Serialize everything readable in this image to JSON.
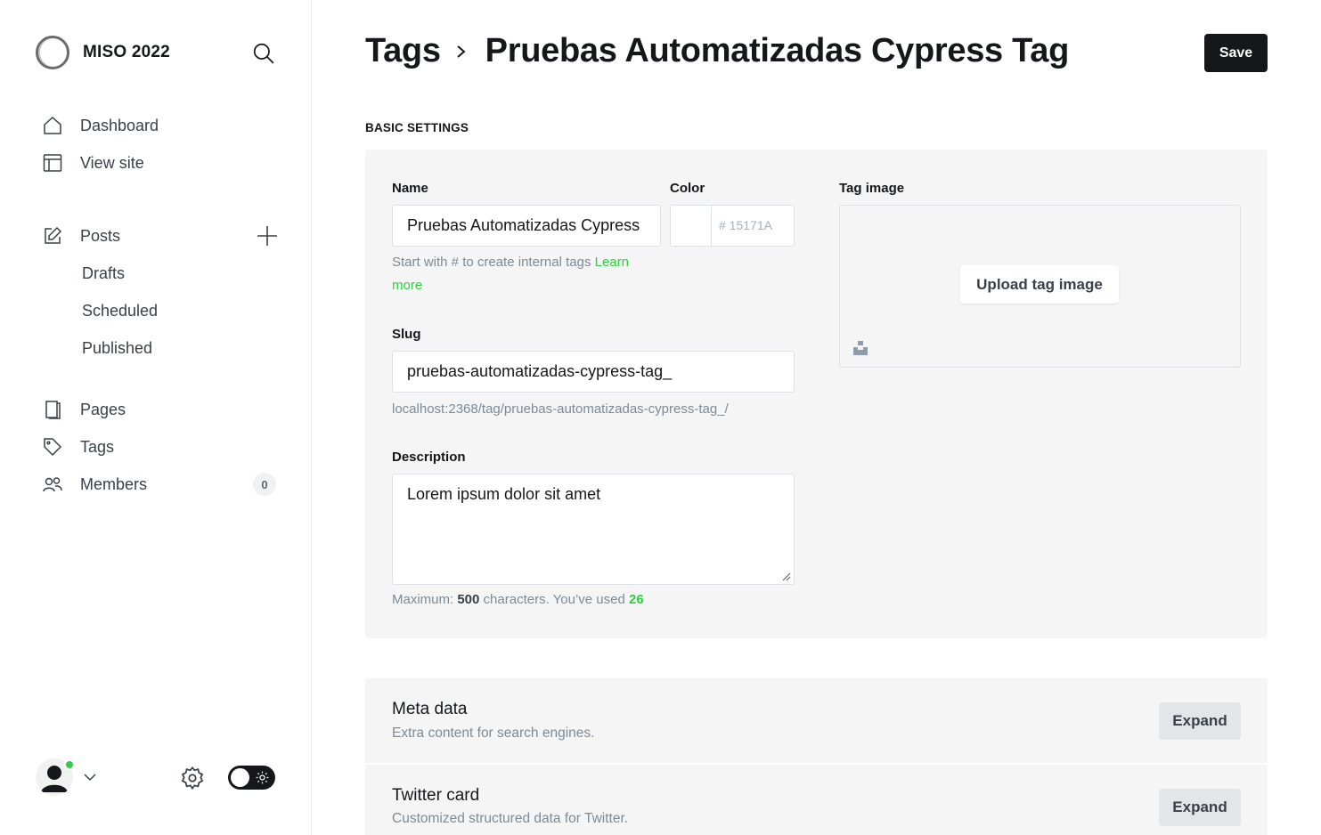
{
  "brand": {
    "name": "MISO 2022"
  },
  "sidebar": {
    "nav": [
      {
        "label": "Dashboard",
        "icon": "home-icon"
      },
      {
        "label": "View site",
        "icon": "layout-icon"
      }
    ],
    "posts": {
      "label": "Posts",
      "icon": "edit-icon"
    },
    "post_subitems": [
      "Drafts",
      "Scheduled",
      "Published"
    ],
    "nav2": [
      {
        "label": "Pages",
        "icon": "page-icon"
      },
      {
        "label": "Tags",
        "icon": "tag-icon"
      },
      {
        "label": "Members",
        "icon": "members-icon",
        "count": "0"
      }
    ]
  },
  "header": {
    "breadcrumb_parent": "Tags",
    "breadcrumb_current": "Pruebas Automatizadas Cypress Tag",
    "save_label": "Save"
  },
  "basic": {
    "section_title": "BASIC SETTINGS",
    "name_label": "Name",
    "name_value": "Pruebas Automatizadas Cypress",
    "name_hint": "Start with # to create internal tags",
    "learn_more": "Learn more",
    "color_label": "Color",
    "color_placeholder": "# 15171A",
    "slug_label": "Slug",
    "slug_value": "pruebas-automatizadas-cypress-tag_",
    "slug_url": "localhost:2368/tag/pruebas-automatizadas-cypress-tag_/",
    "description_label": "Description",
    "description_value": "Lorem ipsum dolor sit amet",
    "counter_prefix": "Maximum:",
    "counter_max": "500",
    "counter_mid": "characters. You’ve used",
    "counter_used": "26",
    "image_label": "Tag image",
    "upload_label": "Upload tag image"
  },
  "sections": [
    {
      "title": "Meta data",
      "subtitle": "Extra content for search engines.",
      "button": "Expand"
    },
    {
      "title": "Twitter card",
      "subtitle": "Customized structured data for Twitter.",
      "button": "Expand"
    }
  ],
  "colors": {
    "accent": "#30cf43",
    "dark": "#15171a",
    "panel": "#f4f5f4"
  }
}
